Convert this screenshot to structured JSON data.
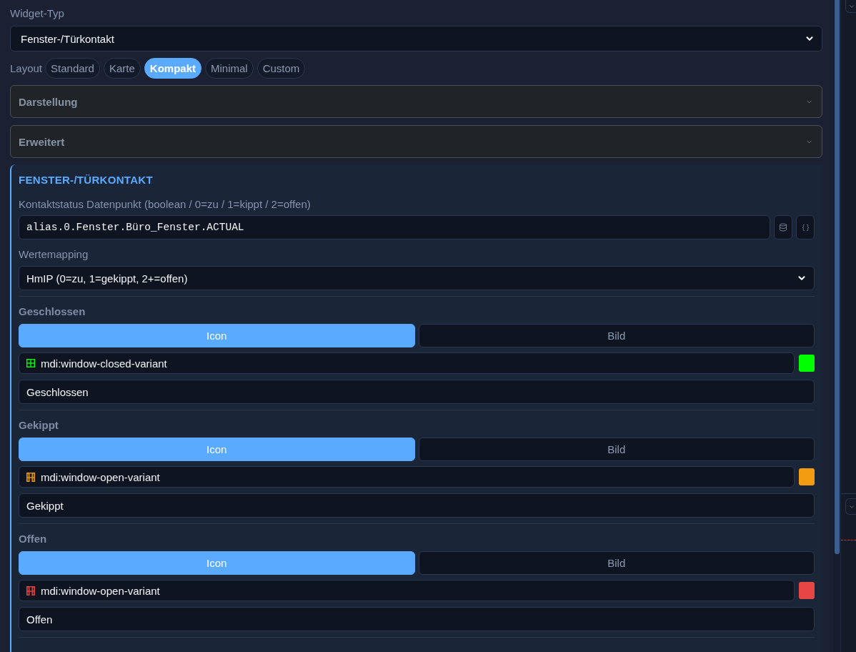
{
  "widget_type": {
    "label": "Widget-Typ",
    "value": "Fenster-/Türkontakt"
  },
  "layout": {
    "label": "Layout",
    "options": [
      {
        "label": "Standard",
        "selected": false
      },
      {
        "label": "Karte",
        "selected": false
      },
      {
        "label": "Kompakt",
        "selected": true
      },
      {
        "label": "Minimal",
        "selected": false
      },
      {
        "label": "Custom",
        "selected": false
      }
    ]
  },
  "accordions": [
    {
      "title": "Darstellung",
      "expanded": false
    },
    {
      "title": "Erweitert",
      "expanded": false
    }
  ],
  "section": {
    "title": "FENSTER-/TÜRKONTAKT",
    "datapoint": {
      "label": "Kontaktstatus Datenpunkt (boolean / 0=zu / 1=kippt / 2=offen)",
      "value": "alias.0.Fenster.Büro_Fenster.ACTUAL"
    },
    "mapping": {
      "label": "Wertemapping",
      "value": "HmIP (0=zu, 1=gekippt, 2+=offen)"
    },
    "states": [
      {
        "label": "Geschlossen",
        "modes": [
          {
            "label": "Icon",
            "selected": true
          },
          {
            "label": "Bild",
            "selected": false
          }
        ],
        "icon": {
          "kind": "closed",
          "value": "mdi:window-closed-variant"
        },
        "color": "#00ff00",
        "text": "Geschlossen"
      },
      {
        "label": "Gekippt",
        "modes": [
          {
            "label": "Icon",
            "selected": true
          },
          {
            "label": "Bild",
            "selected": false
          }
        ],
        "icon": {
          "kind": "open",
          "value": "mdi:window-open-variant"
        },
        "color": "#f39c12",
        "text": "Gekippt"
      },
      {
        "label": "Offen",
        "modes": [
          {
            "label": "Icon",
            "selected": true
          },
          {
            "label": "Bild",
            "selected": false
          }
        ],
        "icon": {
          "kind": "open",
          "value": "mdi:window-open-variant"
        },
        "color": "#e84545",
        "text": "Offen"
      }
    ]
  }
}
